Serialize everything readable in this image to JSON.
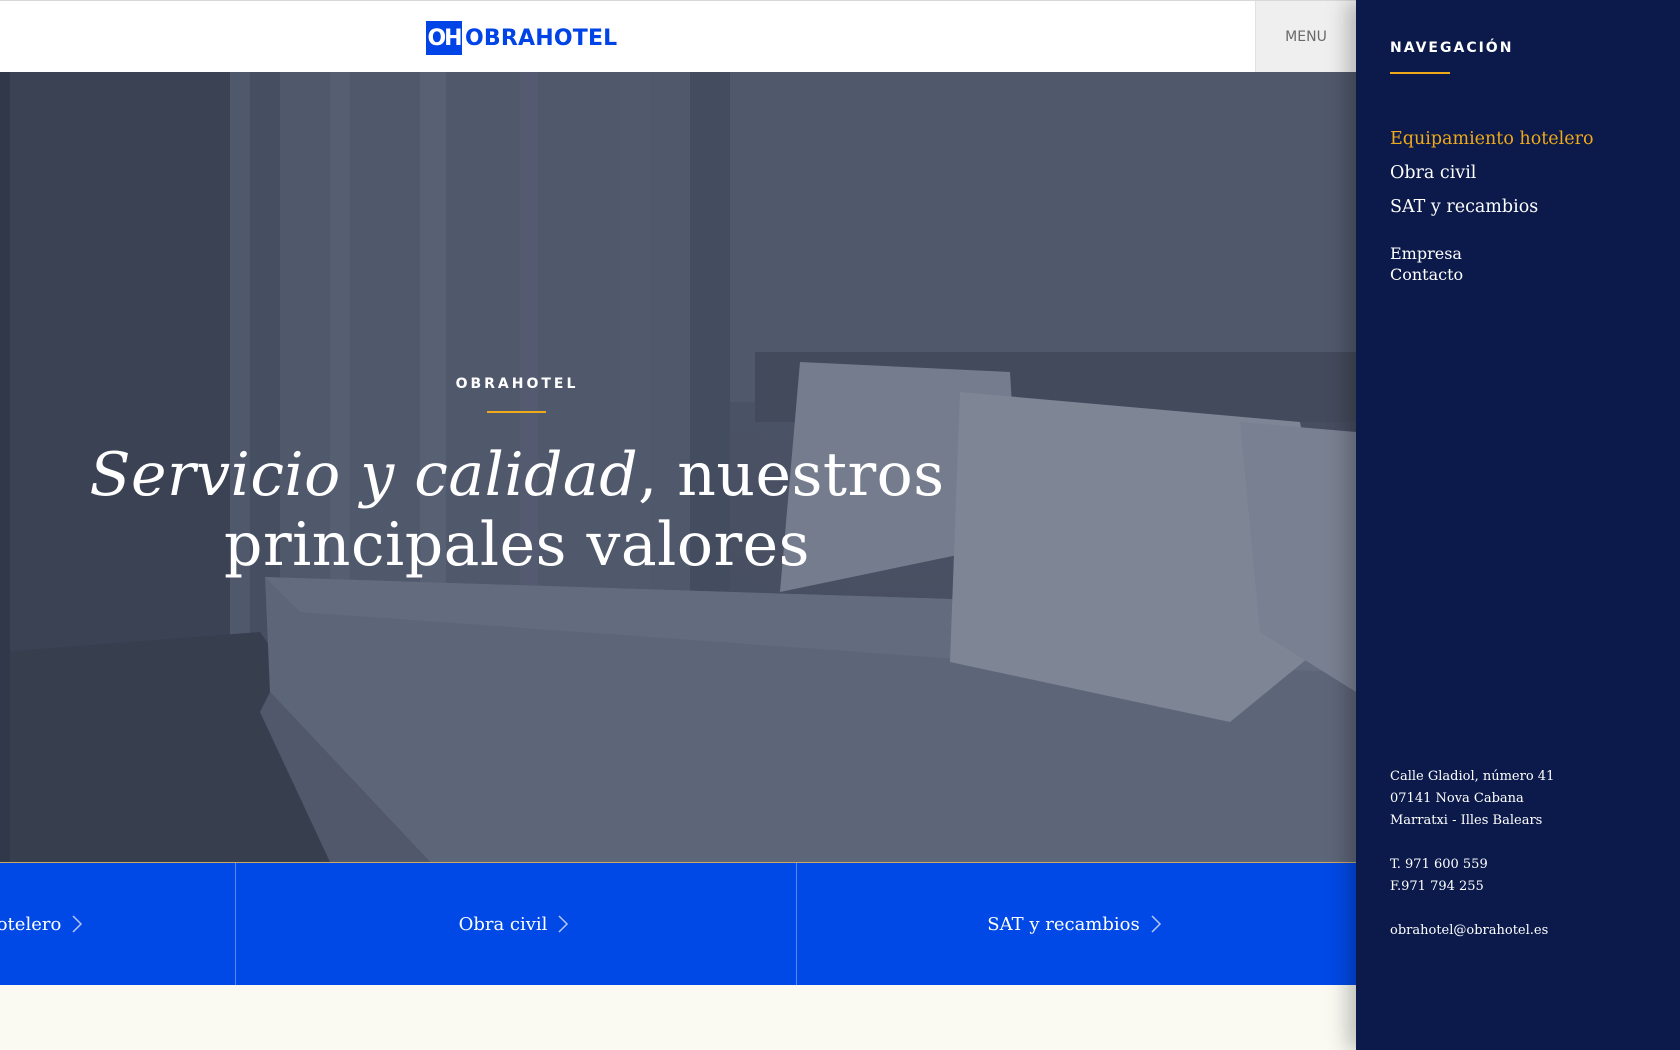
{
  "header": {
    "logo_mark": "OH",
    "logo_text": "OBRAHOTEL",
    "menu_label": "MENU"
  },
  "hero": {
    "kicker": "OBRAHOTEL",
    "title_italic": "Servicio y calidad",
    "title_rest_line1": ", nuestros",
    "title_line2": "principales valores"
  },
  "categories": [
    {
      "label": "Equipamiento hotelero"
    },
    {
      "label": "Obra civil"
    },
    {
      "label": "SAT y recambios"
    }
  ],
  "sidebar": {
    "heading": "NAVEGACIÓN",
    "main_items": [
      {
        "label": "Equipamiento hotelero",
        "active": true
      },
      {
        "label": "Obra civil"
      },
      {
        "label": "SAT y recambios"
      }
    ],
    "secondary_items": [
      {
        "label": "Empresa"
      },
      {
        "label": "Contacto"
      }
    ],
    "contact": {
      "address_line1": "Calle Gladiol, número 41",
      "address_line2": "07141 Nova Cabana",
      "address_line3": "Marratxi - Illes Balears",
      "phone": "T. 971 600 559",
      "fax": "F.971 794 255",
      "email": "obrahotel@obrahotel.es"
    }
  },
  "colors": {
    "brand_blue": "#0043e6",
    "accent_gold": "#f0a919",
    "sidebar_navy": "#0b1a4a"
  }
}
